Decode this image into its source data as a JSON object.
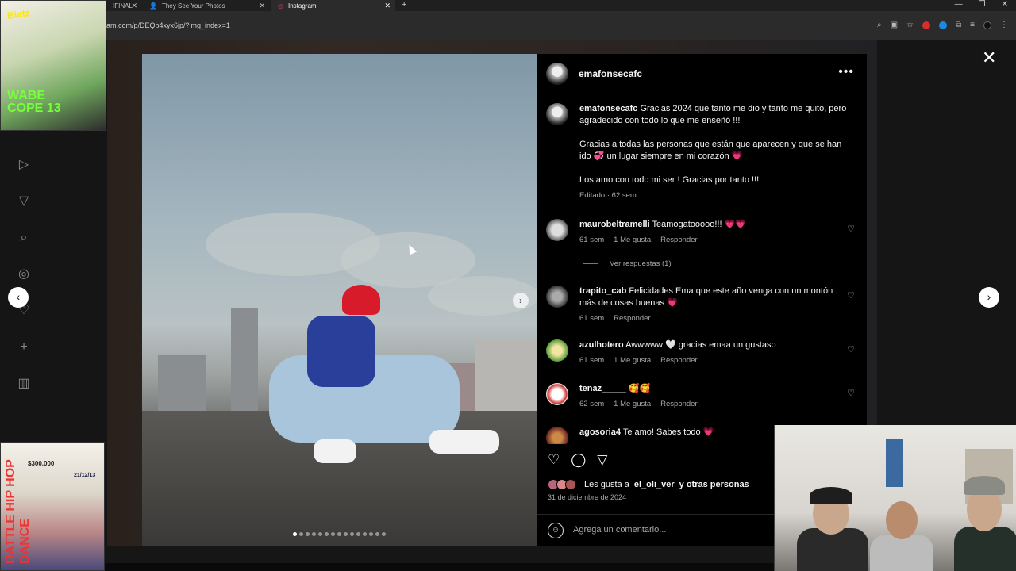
{
  "browser": {
    "tabs": [
      {
        "label": "IFINAL",
        "active": false
      },
      {
        "label": "They See Your Photos",
        "active": false
      },
      {
        "label": "Instagram",
        "active": true
      }
    ],
    "url": "am.com/p/DEQb4xyx6jp/?img_index=1"
  },
  "thumbs": {
    "top_left": {
      "line1": "Biatz",
      "line2": "WABE\nCOPE 13"
    },
    "bottom_left": {
      "vertical": "BATTLE HIP HOP DANCE",
      "price": "$300.000",
      "date": "21/12/13"
    }
  },
  "post": {
    "username": "emafonsecafc",
    "carousel_index": 1,
    "carousel_total": 15
  },
  "caption": {
    "username": "emafonsecafc",
    "text1": "Gracias 2024 que tanto me dio y tanto me quito, pero agradecido con todo lo que me enseñó !!!",
    "text2": "Gracias a todas las personas que están que aparecen y que se han ido 💞 un lugar siempre en mi corazón 💗",
    "text3": "Los amo con todo mi ser ! Gracias por tanto !!!",
    "meta": "Editado · 62 sem"
  },
  "comments": [
    {
      "user": "maurobeltramelli",
      "text": "Teamogatooooo!!! 💗💗",
      "time": "61 sem",
      "likes": "1 Me gusta",
      "reply": "Responder"
    },
    {
      "user": "trapito_cab",
      "text": "Felicidades Ema que este año venga con un montón más de cosas buenas 💗",
      "time": "61 sem",
      "likes": "",
      "reply": "Responder"
    },
    {
      "user": "azulhotero",
      "text": "Awwwww 🤍 gracias emaa un gustaso",
      "time": "61 sem",
      "likes": "1 Me gusta",
      "reply": "Responder"
    },
    {
      "user": "tenaz_____",
      "text": "🥰🥰",
      "time": "62 sem",
      "likes": "1 Me gusta",
      "reply": "Responder"
    },
    {
      "user": "agosoria4",
      "text": "Te amo! Sabes todo 💗"
    }
  ],
  "replies_toggle": "Ver respuestas (1)",
  "likes_line": {
    "prefix": "Les gusta a",
    "user": "el_oli_ver",
    "suffix": "y otras personas"
  },
  "post_date": "31 de diciembre de 2024",
  "comment_placeholder": "Agrega un comentario..."
}
